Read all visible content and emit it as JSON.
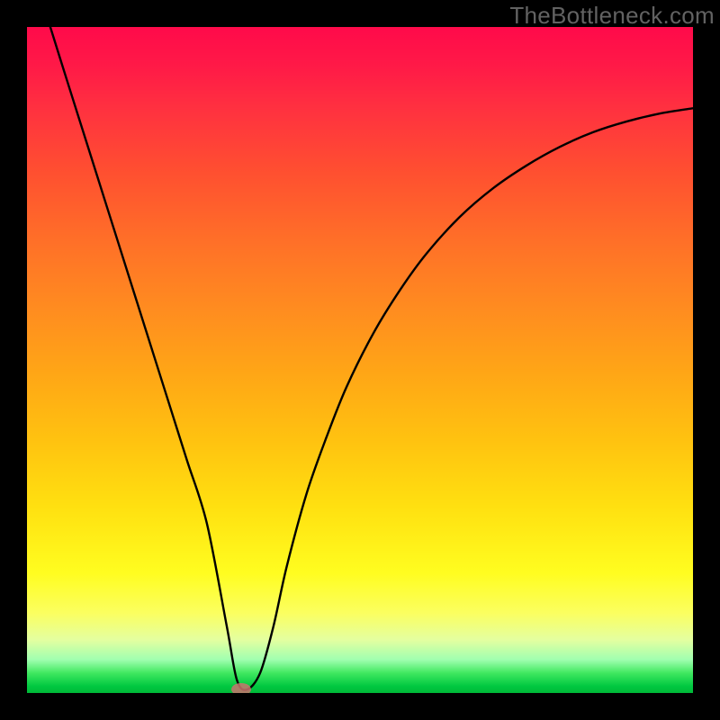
{
  "watermark": {
    "text": "TheBottleneck.com"
  },
  "chart_data": {
    "type": "line",
    "title": "",
    "xlabel": "",
    "ylabel": "",
    "xlim": [
      0,
      100
    ],
    "ylim": [
      0,
      100
    ],
    "series": [
      {
        "name": "bottleneck-curve",
        "x": [
          3.5,
          6,
          9,
          12,
          15,
          18,
          21,
          24,
          27,
          30,
          31.5,
          33,
          35,
          37,
          39,
          42,
          45,
          48,
          52,
          56,
          60,
          65,
          70,
          75,
          80,
          85,
          90,
          95,
          100
        ],
        "values": [
          100,
          92,
          82.5,
          73,
          63.5,
          54,
          44.5,
          35,
          25.5,
          10,
          2,
          0.5,
          3,
          10,
          19,
          30,
          38.5,
          46,
          54,
          60.5,
          66,
          71.5,
          75.8,
          79.2,
          82,
          84.2,
          85.8,
          87,
          87.8
        ]
      }
    ],
    "marker": {
      "x": 32.2,
      "y": 0.5
    },
    "annotations": []
  },
  "colors": {
    "curve_stroke": "#000000",
    "marker_fill": "#c9736f"
  }
}
